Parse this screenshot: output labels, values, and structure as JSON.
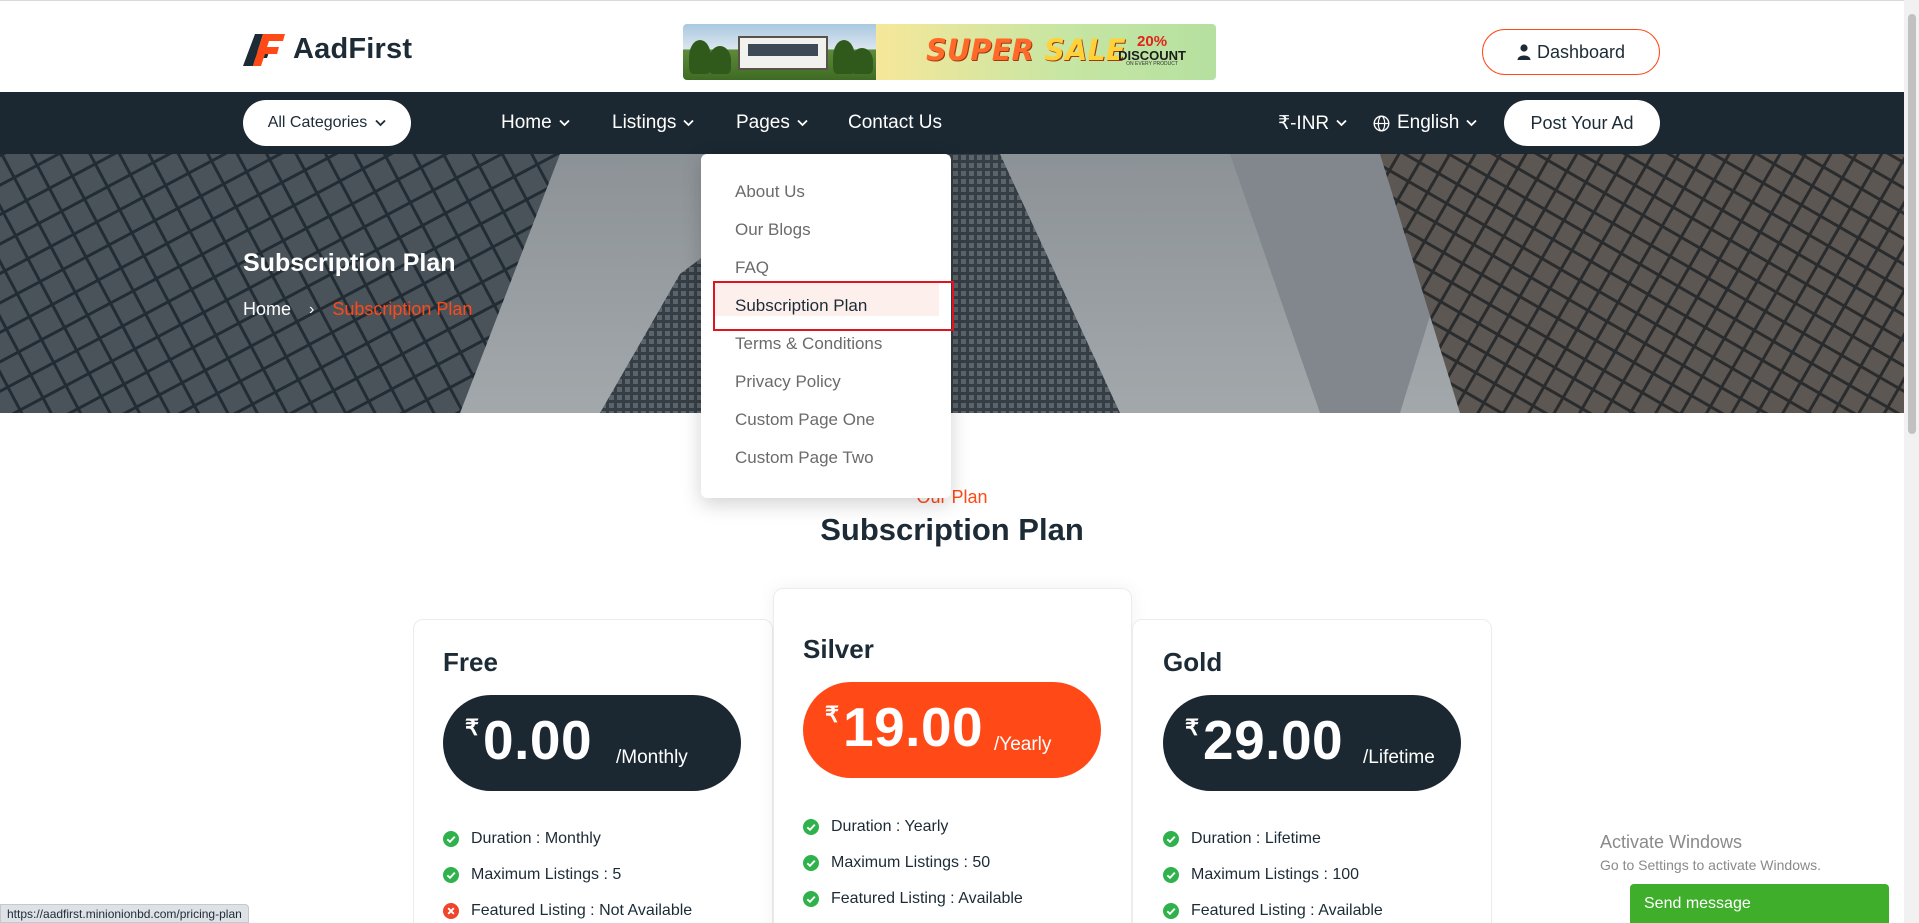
{
  "brand": {
    "name": "AadFirst"
  },
  "banner": {
    "sale_text_1": "SUPER ",
    "sale_text_2": "SALE",
    "discount_pct": "20%",
    "discount_word": "DISCOUNT",
    "discount_tiny": "ON EVERY PRODUCT"
  },
  "header": {
    "dashboard_label": "Dashboard"
  },
  "nav": {
    "categories_label": "All Categories",
    "items": [
      {
        "label": "Home"
      },
      {
        "label": "Listings"
      },
      {
        "label": "Pages"
      },
      {
        "label": "Contact Us"
      }
    ],
    "currency": "₹-INR",
    "language": "English",
    "post_ad": "Post Your Ad"
  },
  "hero": {
    "title": "Subscription Plan",
    "breadcrumb": {
      "home": "Home",
      "separator": "›",
      "current": "Subscription Plan"
    }
  },
  "dropdown": {
    "items": [
      "About Us",
      "Our Blogs",
      "FAQ",
      "Subscription Plan",
      "Terms & Conditions",
      "Privacy Policy",
      "Custom Page One",
      "Custom Page Two"
    ],
    "active_index": 3
  },
  "section": {
    "subtitle": "Our Plan",
    "title": "Subscription Plan"
  },
  "plans": [
    {
      "name": "Free",
      "currency": "₹",
      "price": "0.00",
      "period": "/Monthly",
      "features": [
        {
          "text": "Duration : Monthly",
          "ok": true
        },
        {
          "text": "Maximum Listings : 5",
          "ok": true
        },
        {
          "text": "Featured Listing : Not Available",
          "ok": false
        }
      ]
    },
    {
      "name": "Silver",
      "currency": "₹",
      "price": "19.00",
      "period": "/Yearly",
      "features": [
        {
          "text": "Duration : Yearly",
          "ok": true
        },
        {
          "text": "Maximum Listings : 50",
          "ok": true
        },
        {
          "text": "Featured Listing : Available",
          "ok": true
        }
      ]
    },
    {
      "name": "Gold",
      "currency": "₹",
      "price": "29.00",
      "period": "/Lifetime",
      "features": [
        {
          "text": "Duration : Lifetime",
          "ok": true
        },
        {
          "text": "Maximum Listings : 100",
          "ok": true
        },
        {
          "text": "Featured Listing : Available",
          "ok": true
        }
      ]
    }
  ],
  "windows": {
    "line1": "Activate Windows",
    "line2": "Go to Settings to activate Windows."
  },
  "chat": {
    "label": "Send message"
  },
  "status_bar": {
    "url": "https://aadfirst.minionionbd.com/pricing-plan"
  },
  "colors": {
    "accent": "#ff4a17",
    "dark": "#1b2831",
    "success": "#2fb24c",
    "danger": "#f0442b",
    "highlight_box": "#e0131f"
  }
}
